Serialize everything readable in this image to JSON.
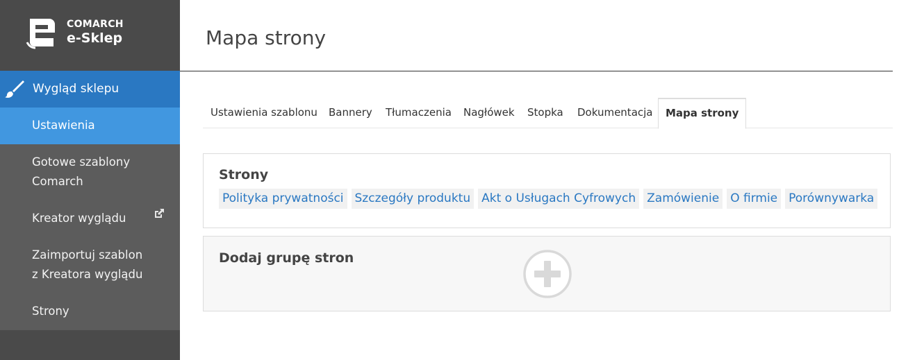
{
  "brand": {
    "line1": "COMARCH",
    "line2": "e-Sklep"
  },
  "sidebar": {
    "section_label": "Wygląd sklepu",
    "items": [
      {
        "label": "Ustawienia",
        "active": true
      },
      {
        "label": "Gotowe szablony Comarch",
        "line1": "Gotowe szablony",
        "line2": "Comarch"
      },
      {
        "label": "Kreator wyglądu"
      },
      {
        "label": "Zaimportuj szablon z Kreatora wyglądu",
        "line1": "Zaimportuj szablon",
        "line2": "z Kreatora wyglądu"
      },
      {
        "label": "Strony"
      }
    ]
  },
  "main": {
    "title": "Mapa strony",
    "tabs": [
      {
        "label": "Ustawienia szablonu"
      },
      {
        "label": "Bannery"
      },
      {
        "label": "Tłumaczenia"
      },
      {
        "label": "Nagłówek"
      },
      {
        "label": "Stopka"
      },
      {
        "label": "Dokumentacja"
      },
      {
        "label": "Mapa strony",
        "active": true
      }
    ],
    "pages_group": {
      "title": "Strony",
      "links": [
        "Polityka prywatności",
        "Szczegóły produktu",
        "Akt o Usługach Cyfrowych",
        "Zamówienie",
        "O firmie",
        "Porównywarka"
      ]
    },
    "add_group": {
      "title": "Dodaj grupę stron"
    }
  },
  "colors": {
    "sidebar_bg": "#4a4a4a",
    "sidebar_sub_bg": "#5c5c5c",
    "section_active": "#2a78c2",
    "item_active": "#4197e0",
    "link": "#2a78c2"
  },
  "icons": {
    "logo": "comarch-e-logo",
    "section": "paintbrush-icon",
    "external": "external-link-icon",
    "add": "plus-circle-icon"
  }
}
